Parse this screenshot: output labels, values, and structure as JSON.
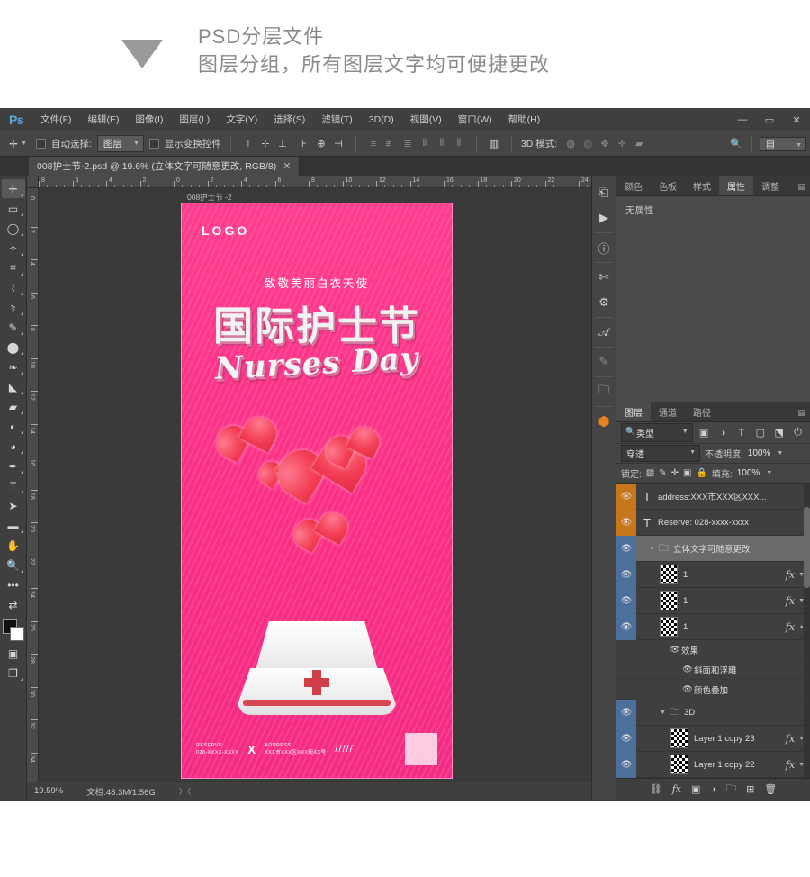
{
  "banner": {
    "line1": "PSD分层文件",
    "line2": "图层分组，所有图层文字均可便捷更改",
    "arrow_icon": "triangle-down-icon"
  },
  "app": {
    "logo": "Ps",
    "menus": [
      "文件(F)",
      "编辑(E)",
      "图像(I)",
      "图层(L)",
      "文字(Y)",
      "选择(S)",
      "滤镜(T)",
      "3D(D)",
      "视图(V)",
      "窗口(W)",
      "帮助(H)"
    ],
    "window_controls": {
      "minimize": "—",
      "maximize": "▭",
      "close": "✕"
    }
  },
  "options_bar": {
    "tool_icon": "move-tool-icon",
    "auto_select_label": "自动选择:",
    "auto_select_value": "图层",
    "show_transform_label": "显示变换控件",
    "mode3d_label": "3D 模式:",
    "align_icons": [
      "align-top-icon",
      "align-vcenter-icon",
      "align-bottom-icon",
      "align-left-icon",
      "align-hcenter-icon",
      "align-right-icon"
    ],
    "distribute_icons": [
      "dist-top-icon",
      "dist-vcenter-icon",
      "dist-bottom-icon",
      "dist-left-icon",
      "dist-hcenter-icon",
      "dist-right-icon"
    ],
    "auto_align_icon": "auto-align-icon",
    "mode3d_icons": [
      "3d-rotate-icon",
      "3d-roll-icon",
      "3d-pan-icon",
      "3d-slide-icon",
      "3d-scale-icon"
    ],
    "search_icon": "search-icon",
    "workspace_icon": "workspace-icon"
  },
  "document": {
    "tab_title": "008护士节-2.psd @ 19.6% (立体文字可随意更改, RGB/8)",
    "close_icon": "✕",
    "canvas_label": "008护士节 -2"
  },
  "rulers": {
    "horizontal": [
      "8",
      "6",
      "4",
      "2",
      "0",
      "2",
      "4",
      "6",
      "8",
      "10",
      "12",
      "14",
      "16",
      "18",
      "20",
      "22",
      "24"
    ],
    "vertical": [
      "0",
      "2",
      "4",
      "6",
      "8",
      "10",
      "12",
      "14",
      "16",
      "18",
      "20",
      "22",
      "24",
      "26",
      "28",
      "30",
      "32",
      "34"
    ]
  },
  "toolbar": {
    "tools": [
      {
        "name": "move-tool",
        "glyph": "✛",
        "active": true
      },
      {
        "name": "marquee-tool",
        "glyph": "▭",
        "active": false
      },
      {
        "name": "lasso-tool",
        "glyph": "◯",
        "active": false
      },
      {
        "name": "magic-wand-tool",
        "glyph": "✧",
        "active": false
      },
      {
        "name": "crop-tool",
        "glyph": "⌗",
        "active": false
      },
      {
        "name": "eyedropper-tool",
        "glyph": "⌇",
        "active": false
      },
      {
        "name": "healing-brush-tool",
        "glyph": "⚕",
        "active": false
      },
      {
        "name": "brush-tool",
        "glyph": "✎",
        "active": false
      },
      {
        "name": "clone-stamp-tool",
        "glyph": "⬤",
        "active": false
      },
      {
        "name": "history-brush-tool",
        "glyph": "❧",
        "active": false
      },
      {
        "name": "eraser-tool",
        "glyph": "◣",
        "active": false
      },
      {
        "name": "gradient-tool",
        "glyph": "▰",
        "active": false
      },
      {
        "name": "blur-tool",
        "glyph": "💧",
        "active": false
      },
      {
        "name": "dodge-tool",
        "glyph": "◕",
        "active": false
      },
      {
        "name": "pen-tool",
        "glyph": "✒",
        "active": false
      },
      {
        "name": "type-tool",
        "glyph": "T",
        "active": false
      },
      {
        "name": "path-selection-tool",
        "glyph": "➤",
        "active": false
      },
      {
        "name": "shape-tool",
        "glyph": "▬",
        "active": false
      },
      {
        "name": "hand-tool",
        "glyph": "✋",
        "active": false
      },
      {
        "name": "zoom-tool",
        "glyph": "🔍",
        "active": false
      },
      {
        "name": "more-tools",
        "glyph": "•••",
        "active": false
      }
    ],
    "swap_colors_icon": "swap-colors-icon",
    "foreground_color": "#111111",
    "background_color": "#ffffff",
    "quick_mask_icon": "quick-mask-icon",
    "screen_mode_icon": "screen-mode-icon"
  },
  "poster": {
    "logo": "LOGO",
    "subtitle": "致敬美丽白衣天使",
    "title": "国际护士节",
    "english_title": "Nurses Day",
    "reserve_label": "RESERVE:",
    "reserve_value": "028-XXXX-XXXX",
    "divider": "X",
    "address_label": "ADDRESS:",
    "address_value": "XXX市XXX区XXX街XX号",
    "slashes": "/////",
    "qr_label": "qr-code",
    "bg_color": "#fa2f85",
    "hat_cross_color": "#cf3f48"
  },
  "status_bar": {
    "zoom": "19.59%",
    "doc_info": "文档:48.3M/1.56G",
    "arrows": "〉〈"
  },
  "icon_rail": [
    {
      "name": "history-icon",
      "glyph": "⎗",
      "dim": false
    },
    {
      "name": "actions-play-icon",
      "glyph": "▶",
      "dim": false
    },
    {
      "name": "info-icon",
      "glyph": "ⓘ",
      "dim": false
    },
    {
      "name": "brushes-icon",
      "glyph": "✄",
      "dim": false
    },
    {
      "name": "adjustments-icon",
      "glyph": "⚙",
      "dim": false
    },
    {
      "name": "glyphs-icon",
      "glyph": "𝒜",
      "dim": false
    },
    {
      "name": "paths-icon",
      "glyph": "✎",
      "dim": true
    },
    {
      "name": "library-icon",
      "glyph": "🗀",
      "dim": false
    },
    {
      "name": "3d-icon",
      "glyph": "⬢",
      "dim": false
    }
  ],
  "property_panel": {
    "tabs": [
      "颜色",
      "色板",
      "样式",
      "属性",
      "调整"
    ],
    "active_tab": "属性",
    "body_text": "无属性",
    "menu_icon": "panel-menu-icon"
  },
  "layers_panel": {
    "tabs": [
      "图层",
      "通道",
      "路径"
    ],
    "active_tab": "图层",
    "menu_icon": "panel-menu-icon",
    "filter_value": "类型",
    "filter_icons": [
      "filter-pixel-icon",
      "filter-adjustment-icon",
      "filter-type-icon",
      "filter-shape-icon",
      "filter-smart-icon",
      "filter-toggle-icon"
    ],
    "blend_mode": "穿透",
    "opacity_label": "不透明度:",
    "opacity_value": "100%",
    "lock_label": "锁定:",
    "lock_icons": [
      "lock-transparent-icon",
      "lock-image-icon",
      "lock-position-icon",
      "lock-artboard-icon",
      "lock-all-icon"
    ],
    "fill_label": "填充:",
    "fill_value": "100%",
    "layers": [
      {
        "name": "address:XXX市XXX区XXX...",
        "kind": "text",
        "eye": "orange",
        "selected": false,
        "fx": false,
        "indent": 0
      },
      {
        "name": "Reserve: 028-xxxx-xxxx",
        "kind": "text",
        "eye": "orange",
        "selected": false,
        "fx": false,
        "indent": 0
      },
      {
        "name": "立体文字可随意更改",
        "kind": "group",
        "eye": "blue",
        "selected": true,
        "fx": false,
        "indent": 0
      },
      {
        "name": "1",
        "kind": "raster",
        "eye": "blue",
        "selected": false,
        "fx": true,
        "indent": 1
      },
      {
        "name": "1",
        "kind": "raster",
        "eye": "blue",
        "selected": false,
        "fx": true,
        "indent": 1
      },
      {
        "name": "1",
        "kind": "raster",
        "eye": "blue",
        "selected": false,
        "fx": true,
        "indent": 1
      }
    ],
    "effects": [
      {
        "name": "效果",
        "level": 1
      },
      {
        "name": "斜面和浮雕",
        "level": 2
      },
      {
        "name": "颜色叠加",
        "level": 2
      }
    ],
    "layers_bottom": [
      {
        "name": "3D",
        "kind": "group",
        "eye": "blue",
        "selected": false,
        "fx": false,
        "indent": 1
      },
      {
        "name": "Layer 1 copy 23",
        "kind": "raster",
        "eye": "blue",
        "selected": false,
        "fx": true,
        "indent": 2
      },
      {
        "name": "Layer 1 copy 22",
        "kind": "raster",
        "eye": "blue",
        "selected": false,
        "fx": true,
        "indent": 2
      }
    ],
    "footer_icons": [
      {
        "name": "link-layers-icon",
        "glyph": "⛓"
      },
      {
        "name": "layer-style-fx-icon",
        "glyph": "fx"
      },
      {
        "name": "add-mask-icon",
        "glyph": "▣"
      },
      {
        "name": "adjustment-layer-icon",
        "glyph": "◑"
      },
      {
        "name": "new-group-icon",
        "glyph": "🗀"
      },
      {
        "name": "new-layer-icon",
        "glyph": "⊞"
      },
      {
        "name": "delete-layer-icon",
        "glyph": "🗑"
      }
    ]
  }
}
